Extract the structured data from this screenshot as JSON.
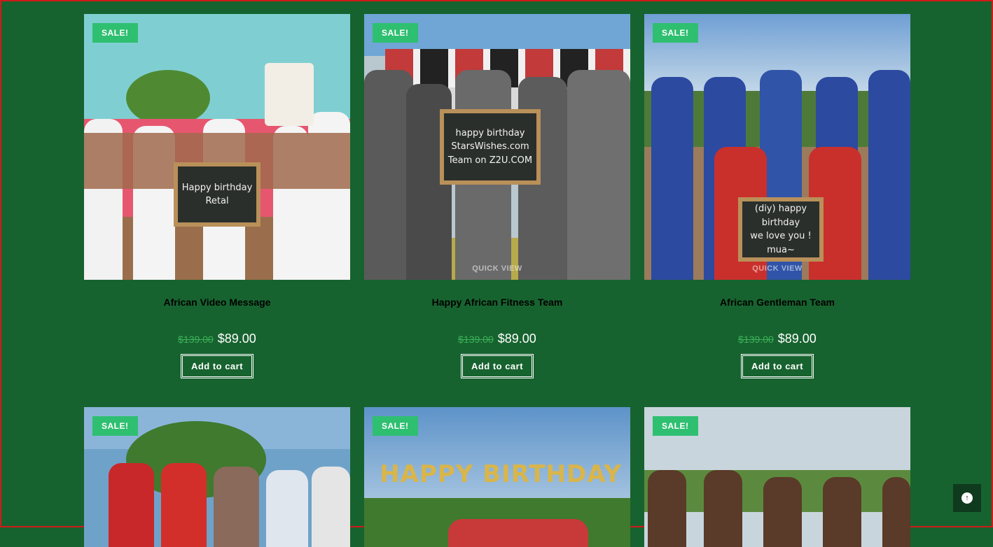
{
  "products": [
    {
      "sale": "SALE!",
      "title": "African Video Message",
      "old_price": "$139.00",
      "price": "$89.00",
      "cta": "Add to cart",
      "board": [
        "Happy birthday",
        "Retal"
      ]
    },
    {
      "sale": "SALE!",
      "title": "Happy African Fitness Team",
      "old_price": "$139.00",
      "price": "$89.00",
      "cta": "Add to cart",
      "board": [
        "happy birthday",
        "StarsWishes.com",
        "Team on Z2U.COM"
      ],
      "overlay": "QUICK VIEW"
    },
    {
      "sale": "SALE!",
      "title": "African Gentleman Team",
      "old_price": "$139.00",
      "price": "$89.00",
      "cta": "Add to cart",
      "board": [
        "(diy) happy birthday",
        "we love you !",
        "mua~"
      ],
      "overlay": "QUICK VIEW"
    },
    {
      "sale": "SALE!"
    },
    {
      "sale": "SALE!",
      "banner": "HAPPY BIRTHDAY"
    },
    {
      "sale": "SALE!"
    }
  ],
  "colors": {
    "background": "#17632f",
    "sale_badge": "#2fbf71",
    "old_price": "#3cb25a"
  },
  "icons": {
    "scroll_top": "arrow-up-circle-icon"
  }
}
